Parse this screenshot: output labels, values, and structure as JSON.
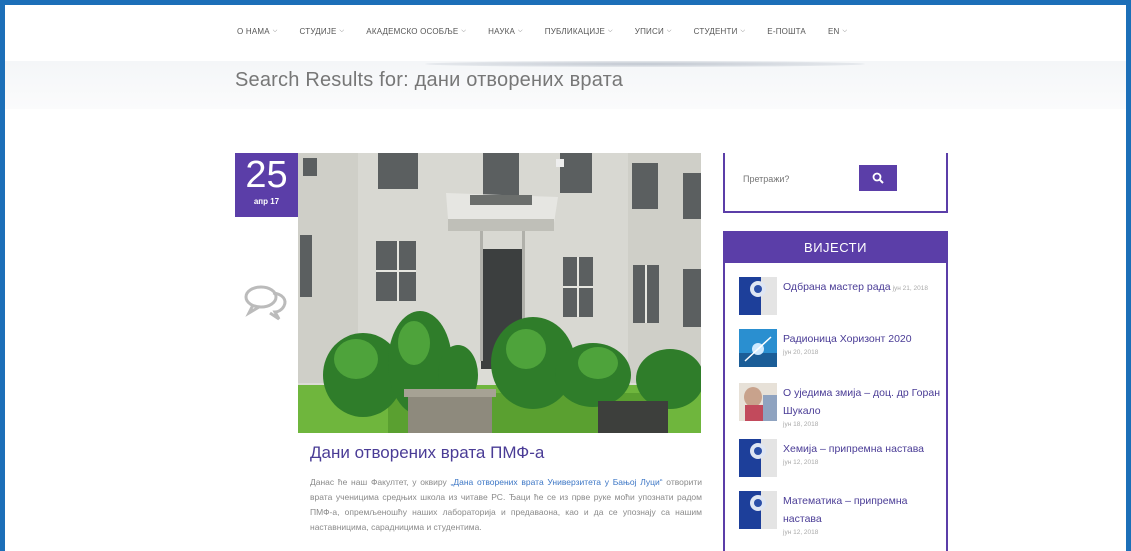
{
  "nav": {
    "items": [
      {
        "label": "О НАМА",
        "has_dropdown": true
      },
      {
        "label": "СТУДИЈЕ",
        "has_dropdown": true
      },
      {
        "label": "АКАДЕМСКО ОСОБЉЕ",
        "has_dropdown": true
      },
      {
        "label": "НАУКА",
        "has_dropdown": true
      },
      {
        "label": "ПУБЛИКАЦИЈЕ",
        "has_dropdown": true
      },
      {
        "label": "УПИСИ",
        "has_dropdown": true
      },
      {
        "label": "СТУДЕНТИ",
        "has_dropdown": true
      },
      {
        "label": "Е-ПОШТА",
        "has_dropdown": false
      },
      {
        "label": "EN",
        "has_dropdown": true
      }
    ]
  },
  "page": {
    "title": "Search Results for: дани отворених врата"
  },
  "post": {
    "date_day": "25",
    "date_month": "апр 17",
    "title": "Дани отворених врата ПМФ-а",
    "body_before": "Данас ће наш Факултет, у оквиру ",
    "body_link": "„Дана отворених врата Универзитета у Бањој Луци“",
    "body_after": " отворити врата ученицима средњих школа из читаве РС. Ђаци ће се из прве руке моћи упознати радом ПМФ-а, опремљеношћу наших лабораторија и предаваона, као и да се упознају са нашим наставницима, сарадницима и студентима."
  },
  "search": {
    "placeholder": "Претражи?"
  },
  "news": {
    "header": "ВИЈЕСТИ",
    "items": [
      {
        "title": "Одбрана мастер рада",
        "date": "јун 21, 2018"
      },
      {
        "title": "Радионица Хоризонт 2020",
        "date": "јун 20, 2018"
      },
      {
        "title": "О уједима змија – доц. др Горан Шукало",
        "date": "јун 18, 2018"
      },
      {
        "title": "Хемија – припремна настава",
        "date": "јун 12, 2018"
      },
      {
        "title": "Математика – припремна настава",
        "date": "јун 12, 2018"
      }
    ]
  },
  "colors": {
    "accent": "#5b3ea8",
    "frame": "#1c6fb8",
    "link": "#3d77c6"
  }
}
